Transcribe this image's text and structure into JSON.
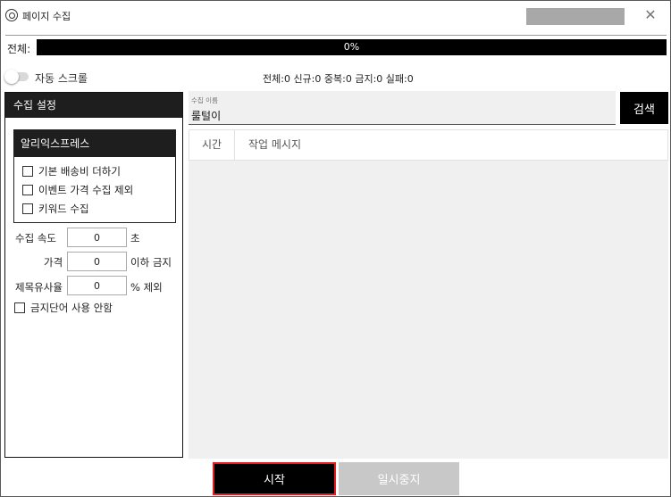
{
  "window": {
    "title": "페이지 수집",
    "close_glyph": "✕"
  },
  "progress": {
    "label": "전체:",
    "percent": 0,
    "text": "0%",
    "bar_color": "#000000"
  },
  "auto_scroll": {
    "label": "자동 스크롤",
    "enabled": false
  },
  "stats": {
    "text": "전체:0 신규:0 중복:0 금지:0 실패:0"
  },
  "settings": {
    "header": "수집 설정",
    "aliexpress": {
      "header": "알리익스프레스",
      "options": [
        {
          "label": "기본 배송비 더하기",
          "checked": false
        },
        {
          "label": "이벤트 가격 수집 제외",
          "checked": false
        },
        {
          "label": "키워드 수집",
          "checked": false
        }
      ]
    },
    "speed": {
      "label": "수집 속도",
      "value": "0",
      "unit": "초"
    },
    "price": {
      "label": "가격",
      "value": "0",
      "unit": "이하 금지"
    },
    "similarity": {
      "label": "제목유사율",
      "value": "0",
      "unit": "% 제외"
    },
    "banned_words": {
      "label": "금지단어 사용 안함",
      "checked": false
    }
  },
  "search": {
    "caption": "수집 이름",
    "value": "룰털이",
    "button_label": "검색"
  },
  "log": {
    "columns": [
      "시간",
      "작업 메시지"
    ],
    "rows": []
  },
  "actions": {
    "start_label": "시작",
    "pause_label": "일시중지"
  },
  "colors": {
    "dark": "#1e1e1e",
    "start_border": "#e02020",
    "disabled": "#c8c8c8"
  }
}
